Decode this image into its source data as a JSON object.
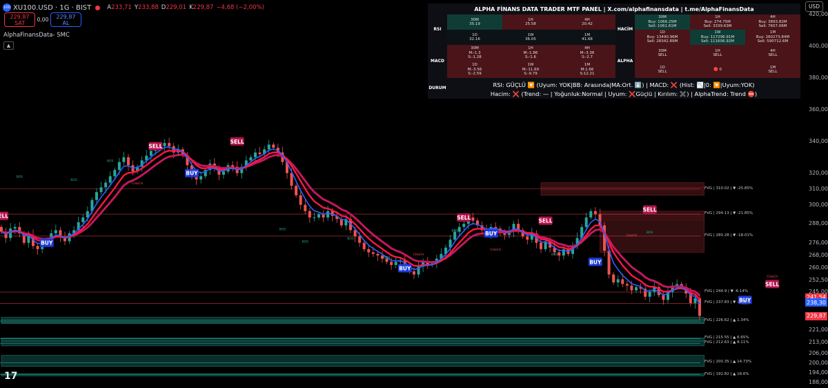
{
  "header": {
    "symbol": "XU100.USD · 1G · BIST",
    "symbol_badge": "100",
    "ohlc": [
      {
        "k": "A",
        "v": "233,71"
      },
      {
        "k": "Y",
        "v": "233,88"
      },
      {
        "k": "D",
        "v": "229,01"
      },
      {
        "k": "K",
        "v": "229,87"
      }
    ],
    "change": "−4,68 (−2,00%)",
    "sell_price": "229,87",
    "sell_label": "SAT",
    "spread": "0,00",
    "buy_price": "229,87",
    "buy_label": "AL",
    "indicator_name": "AlphaFinansData- SMC",
    "currency": "USD"
  },
  "colors": {
    "bull": "#26a69a",
    "bear": "#ef5350",
    "sell": "#f23645",
    "buy": "#2962ff",
    "fvg_bear_fill": "#3d1114",
    "fvg_bull_fill": "#0d3a34"
  },
  "price_labels": [
    {
      "value": 241.54,
      "text": "241,54",
      "color": "#f23645"
    },
    {
      "value": 238.3,
      "text": "238,30",
      "color": "#2962ff"
    },
    {
      "value": 229.87,
      "text": "229,87",
      "color": "#f23645"
    }
  ],
  "panel": {
    "title": "ALPHA FİNANS DATA TRADER MTF PANEL  |  X.com/alphafinansdata  |  t.me/AlphaFinansData",
    "rsi_label": "RSI",
    "hacim_label": "HACİM",
    "macd_label": "MACD",
    "alpha_label": "ALPHA",
    "durum_label": "DURUM",
    "rsi": [
      {
        "tf": "30M",
        "val": "35.19"
      },
      {
        "tf": "1H",
        "val": "25.58"
      },
      {
        "tf": "4H",
        "val": "20.42"
      },
      {
        "tf": "1D",
        "val": "32.16"
      },
      {
        "tf": "1W",
        "val": "36.05"
      },
      {
        "tf": "1M",
        "val": "41.68"
      }
    ],
    "hacim": [
      {
        "tf": "30M",
        "buy": "Buy: 1066.25M",
        "sell": "Sell: 1061.61M"
      },
      {
        "tf": "1H",
        "buy": "Buy: 274.75M",
        "sell": "Sell: 3339.63M"
      },
      {
        "tf": "4H",
        "buy": "Buy: 3893.82M",
        "sell": "Sell: 7607.06M"
      },
      {
        "tf": "1D",
        "buy": "Buy: 13490.96M",
        "sell": "Sell: 28342.89M"
      },
      {
        "tf": "1W",
        "buy": "Buy: 117296.91M",
        "sell": "Sell: 111606.92M"
      },
      {
        "tf": "1M",
        "buy": "Buy: 260273.84M",
        "sell": "Sell: 590712.6M"
      }
    ],
    "macd": [
      {
        "tf": "30M",
        "m": "M:-1.3",
        "s": "S:-1.28"
      },
      {
        "tf": "1H",
        "m": "M:-1.86",
        "s": "S:-1.6"
      },
      {
        "tf": "4H",
        "m": "M:-3.36",
        "s": "S:-2.7"
      },
      {
        "tf": "1D",
        "m": "M:-3.56",
        "s": "S:-2.59"
      },
      {
        "tf": "1W",
        "m": "M:-11.69",
        "s": "S:-9.79"
      },
      {
        "tf": "1M",
        "m": "M:1.66",
        "s": "S:12.21"
      }
    ],
    "alpha": [
      {
        "tf": "30M",
        "sig": "SELL"
      },
      {
        "tf": "1H",
        "sig": "SELL"
      },
      {
        "tf": "4H",
        "sig": "SELL"
      },
      {
        "tf": "1D",
        "sig": "SELL"
      },
      {
        "tf": "",
        "sig": "🔴 0"
      },
      {
        "tf": "1M",
        "sig": "SELL"
      }
    ],
    "status_line1": "RSI: GÜÇLÜ 🔽 (Uyum: YOK|BB: Arasında|MA:Ort. ⬇️) | MACD: ❌ (Hist: 📉|0: 🔽|Uyum:YOK)",
    "status_line2": "Hacim: ❌ (Trend: — | Yoğunluk:Normal | Uyum: ❌Güçlü | Kırılım: ✖️) | AlphaTrend: Trend ⛔)"
  },
  "chart_data": {
    "type": "candlestick",
    "title": "XU100.USD · 1G · BIST",
    "xlabel": "",
    "ylabel": "",
    "ylim": [
      187,
      424
    ],
    "y_ticks": [
      420,
      400,
      380,
      360,
      340,
      320,
      310,
      300,
      288,
      276,
      268,
      260,
      252.5,
      245,
      229.87,
      221,
      213,
      206,
      200,
      194,
      188
    ],
    "y_tick_labels": [
      "420,00",
      "400,00",
      "380,00",
      "360,00",
      "340,00",
      "320,00",
      "310,00",
      "300,00",
      "288,00",
      "276,00",
      "268,00",
      "260,00",
      "252,50",
      "245,00",
      "229,87",
      "221,00",
      "213,00",
      "206,00",
      "200,00",
      "194,00",
      "188,00"
    ],
    "grid": false,
    "closes": [
      283,
      279,
      285,
      286,
      282,
      276,
      281,
      274,
      272,
      276,
      278,
      282,
      284,
      280,
      277,
      282,
      284,
      289,
      292,
      296,
      303,
      308,
      311,
      314,
      318,
      322,
      327,
      330,
      325,
      321,
      324,
      328,
      331,
      334,
      336,
      337,
      339,
      337,
      333,
      335,
      331,
      325,
      318,
      316,
      318,
      322,
      326,
      323,
      319,
      321,
      325,
      324,
      320,
      324,
      328,
      330,
      333,
      332,
      335,
      338,
      336,
      333,
      327,
      320,
      312,
      306,
      300,
      296,
      292,
      292,
      294,
      292,
      296,
      293,
      291,
      287,
      291,
      284,
      280,
      276,
      272,
      270,
      269,
      268,
      266,
      264,
      262,
      264,
      265,
      261,
      258,
      256,
      261,
      264,
      262,
      263,
      266,
      269,
      273,
      278,
      283,
      286,
      288,
      292,
      290,
      287,
      284,
      282,
      286,
      285,
      282,
      281,
      283,
      288,
      284,
      280,
      278,
      282,
      276,
      272,
      277,
      273,
      270,
      268,
      272,
      269,
      274,
      279,
      286,
      292,
      296,
      294,
      287,
      271,
      256,
      251,
      253,
      250,
      249,
      246,
      248,
      247,
      242,
      245,
      248,
      243,
      240,
      245,
      249,
      250,
      248,
      244,
      238,
      241,
      229.87
    ],
    "rectangles": [
      {
        "x0": 119,
        "x1": 155,
        "y0": 309,
        "y1": 314,
        "kind": "bear"
      },
      {
        "x0": 119,
        "x1": 155,
        "y0": 306,
        "y1": 311,
        "kind": "bear"
      },
      {
        "x0": 132,
        "x1": 155,
        "y0": 290,
        "y1": 296,
        "kind": "bear"
      },
      {
        "x0": 132,
        "x1": 155,
        "y0": 270,
        "y1": 294,
        "kind": "bear"
      },
      {
        "x0": 0,
        "x1": 155,
        "y0": 225,
        "y1": 229,
        "kind": "bull"
      },
      {
        "x0": 0,
        "x1": 155,
        "y0": 225.5,
        "y1": 227.5,
        "kind": "bull"
      },
      {
        "x0": 0,
        "x1": 155,
        "y0": 214,
        "y1": 216,
        "kind": "bull"
      },
      {
        "x0": 0,
        "x1": 155,
        "y0": 211,
        "y1": 214,
        "kind": "bull"
      },
      {
        "x0": 0,
        "x1": 155,
        "y0": 198,
        "y1": 205,
        "kind": "bull"
      },
      {
        "x0": 0,
        "x1": 155,
        "y0": 192,
        "y1": 193.5,
        "kind": "bull"
      }
    ],
    "fvg_labels": [
      {
        "value": 310.02,
        "text": "FVG | 310.02 | ▼ -25.85%"
      },
      {
        "value": 294.13,
        "text": "FVG | 294.13 | ▼ -21.85%"
      },
      {
        "value": 280.28,
        "text": "FVG | 280.28 | ▼ -18.01%"
      },
      {
        "value": 244.9,
        "text": "FVG | 244.9 | ▼ -6.14%"
      },
      {
        "value": 237.83,
        "text": "FVG | 237.83 | ▼ -3.35%"
      },
      {
        "value": 226.62,
        "text": "FVG | 226.62 | ▲ 1.34%"
      },
      {
        "value": 215.55,
        "text": "FVG | 215.55 | ▲ 6.65%"
      },
      {
        "value": 212.63,
        "text": "FVG | 212.63 | ▲ 8.11%"
      },
      {
        "value": 200.35,
        "text": "FVG | 200.35 | ▲ 14.73%"
      },
      {
        "value": 192.82,
        "text": "FVG | 192.82 | ▲ 18.6%"
      }
    ],
    "signals": [
      {
        "index": 0,
        "type": "SELL",
        "value": 293
      },
      {
        "index": 10,
        "type": "BUY",
        "value": 276
      },
      {
        "index": 34,
        "type": "SELL",
        "value": 337
      },
      {
        "index": 42,
        "type": "BUY",
        "value": 320
      },
      {
        "index": 52,
        "type": "SELL",
        "value": 340
      },
      {
        "index": 102,
        "type": "SELL",
        "value": 292
      },
      {
        "index": 108,
        "type": "BUY",
        "value": 282
      },
      {
        "index": 120,
        "type": "SELL",
        "value": 290
      },
      {
        "index": 131,
        "type": "BUY",
        "value": 264
      },
      {
        "index": 89,
        "type": "BUY",
        "value": 260
      },
      {
        "index": 143,
        "type": "SELL",
        "value": 297
      },
      {
        "index": 164,
        "type": "BUY",
        "value": 240
      },
      {
        "index": 170,
        "type": "SELL",
        "value": 250
      }
    ],
    "structure_labels": [
      {
        "index": 4,
        "value": 317,
        "text": "BOS"
      },
      {
        "index": 16,
        "value": 315,
        "text": "BOS"
      },
      {
        "index": 24,
        "value": 327,
        "text": "BOS"
      },
      {
        "index": 30,
        "value": 313,
        "text": "CHoCH"
      },
      {
        "index": 62,
        "value": 284,
        "text": "BOS"
      },
      {
        "index": 67,
        "value": 276,
        "text": "BOS"
      },
      {
        "index": 77,
        "value": 278,
        "text": "BOS"
      },
      {
        "index": 85,
        "value": 266,
        "text": "BOS"
      },
      {
        "index": 92,
        "value": 268,
        "text": "CHoCH"
      },
      {
        "index": 100,
        "value": 283,
        "text": "BOS"
      },
      {
        "index": 109,
        "value": 271,
        "text": "CHoCH"
      },
      {
        "index": 122,
        "value": 268,
        "text": "BOS"
      },
      {
        "index": 139,
        "value": 280,
        "text": "CHoCH"
      },
      {
        "index": 143,
        "value": 282,
        "text": "BOS"
      },
      {
        "index": 164,
        "value": 237,
        "text": "BOS"
      },
      {
        "index": 170,
        "value": 254,
        "text": "CHoCH"
      }
    ]
  }
}
